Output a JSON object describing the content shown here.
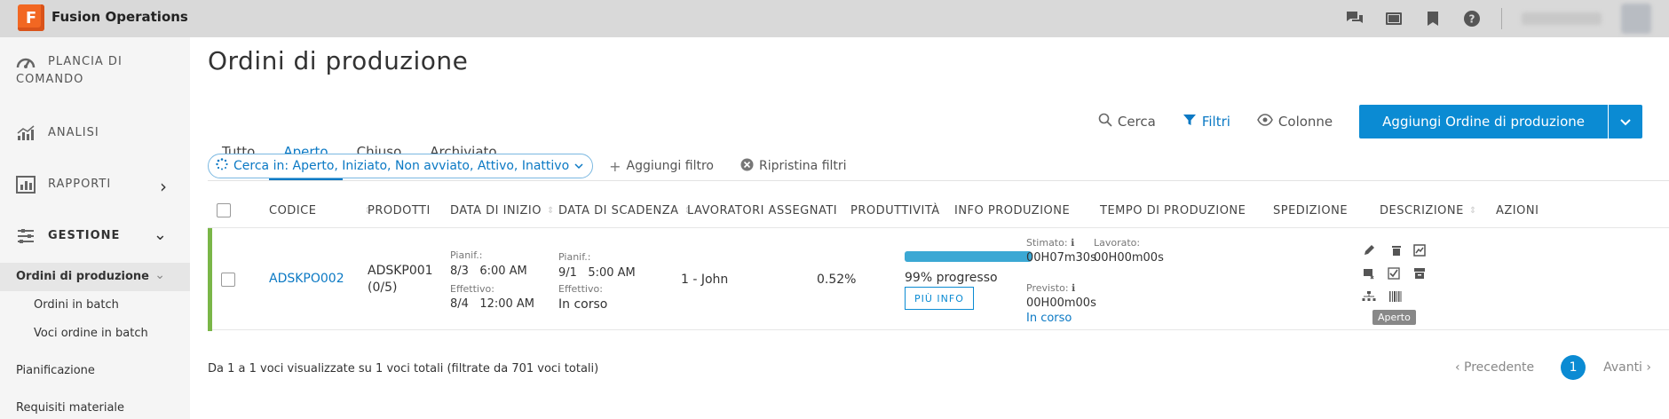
{
  "app": {
    "logo_letter": "F",
    "title": "Fusion Operations"
  },
  "topbar": {
    "icons": [
      "chat-icon",
      "monitor-icon",
      "bookmark-icon",
      "help-icon"
    ]
  },
  "sidebar": {
    "items": [
      {
        "label_line1": "PLANCIA DI",
        "label_line2": "COMANDO",
        "icon": "dashboard-icon"
      },
      {
        "label": "ANALISI",
        "icon": "analytics-icon"
      },
      {
        "label": "RAPPORTI",
        "icon": "reports-icon",
        "chevron": "›"
      },
      {
        "label": "GESTIONE",
        "icon": "management-icon",
        "chevron": "⌄"
      }
    ],
    "sub_items": {
      "production_orders": "Ordini di produzione",
      "batch_orders": "Ordini in batch",
      "batch_order_items": "Voci ordine in batch",
      "planning": "Pianificazione",
      "material_requirements": "Requisiti materiale"
    }
  },
  "main": {
    "title": "Ordini di produzione",
    "tabs": [
      {
        "label": "Tutto",
        "active": false
      },
      {
        "label": "Aperto",
        "active": true
      },
      {
        "label": "Chiuso",
        "active": false
      },
      {
        "label": "Archiviato",
        "active": false
      }
    ],
    "toolbar": {
      "search": "Cerca",
      "filters": "Filtri",
      "columns": "Colonne",
      "add_button": "Aggiungi Ordine di produzione"
    },
    "filters": {
      "chip": "Cerca in: Aperto, Iniziato, Non avviato, Attivo, Inattivo",
      "add_filter": "Aggiungi filtro",
      "reset_filters": "Ripristina filtri"
    },
    "table": {
      "headers": {
        "code": "CODICE",
        "products": "PRODOTTI",
        "start_date": "DATA DI INIZIO",
        "due_date": "DATA DI SCADENZA",
        "workers": "LAVORATORI ASSEGNATI",
        "productivity": "PRODUTTIVITÀ",
        "production_info": "INFO PRODUZIONE",
        "production_time": "TEMPO DI PRODUZIONE",
        "shipping": "SPEDIZIONE",
        "description": "DESCRIZIONE",
        "actions": "AZIONI"
      },
      "rows": [
        {
          "code": "ADSKPO002",
          "product_line1": "ADSKP001",
          "product_line2": "(0/5)",
          "start_planned_label": "Pianif.:",
          "start_planned": "8/3   6:00 AM",
          "start_actual_label": "Effettivo:",
          "start_actual": "8/4   12:00 AM",
          "due_planned_label": "Pianif.:",
          "due_planned": "9/1   5:00 AM",
          "due_actual_label": "Effettivo:",
          "due_actual": "In corso",
          "workers": "1 - John",
          "productivity": "0.52%",
          "progress_fraction": 0.99,
          "progress_text": "99% progresso",
          "more_info": "PIÙ INFO",
          "estimated_label": "Stimato:",
          "estimated": "00H07m30s",
          "worked_label": "Lavorato:",
          "worked": "00H00m00s",
          "forecast_label": "Previsto:",
          "forecast": "00H00m00s",
          "time_status": "In corso",
          "status_color": "#7ab648",
          "tooltip": "Aperto"
        }
      ]
    },
    "footer": {
      "summary": "Da 1 a 1 voci visualizzate su 1 voci totali (filtrate da 701 voci totali)",
      "prev": "‹ Precedente",
      "page": "1",
      "next": "Avanti ›"
    }
  },
  "colors": {
    "accent": "#0b8bd3",
    "status_open": "#7ab648",
    "logo": "#f26722"
  }
}
